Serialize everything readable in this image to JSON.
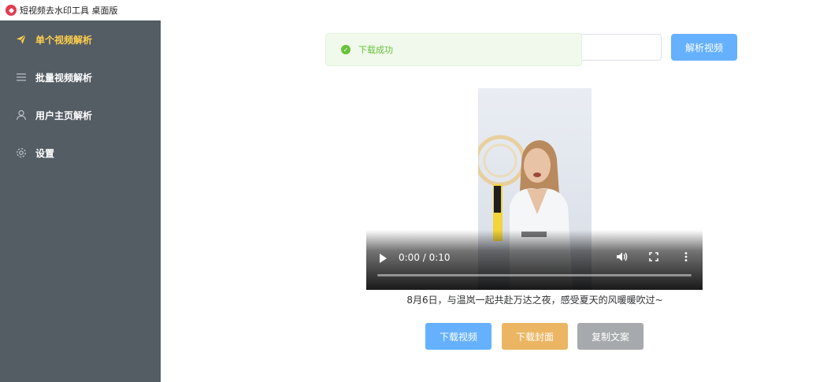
{
  "app": {
    "title": "短视频去水印工具 桌面版",
    "logo_icon": "app-logo-icon"
  },
  "sidebar": {
    "background": "#545c64",
    "active_color": "#ffd04b",
    "text_color": "#ffffff",
    "items": [
      {
        "label": "单个视频解析",
        "icon": "send-icon",
        "active": true
      },
      {
        "label": "批量视频解析",
        "icon": "list-icon",
        "active": false
      },
      {
        "label": "用户主页解析",
        "icon": "user-icon",
        "active": false
      },
      {
        "label": "设置",
        "icon": "gear-icon",
        "active": false
      }
    ]
  },
  "search": {
    "value": "",
    "placeholder": "",
    "parse_label": "解析视频"
  },
  "toast": {
    "text": "下载成功",
    "icon": "check-circle-icon",
    "color": "#67c23a"
  },
  "player": {
    "time": "0:00 / 0:10",
    "progress": 0,
    "controls": [
      "play-icon",
      "volume-icon",
      "fullscreen-icon",
      "more-icon"
    ]
  },
  "caption": "8月6日，与温岚一起共赴万达之夜，感受夏天的风暖暖吹过~",
  "actions": {
    "download_video": {
      "label": "下载视频",
      "color": "#66b1ff"
    },
    "download_cover": {
      "label": "下载封面",
      "color": "#ebb563"
    },
    "copy_text": {
      "label": "复制文案",
      "color": "#a6a9ad"
    }
  }
}
